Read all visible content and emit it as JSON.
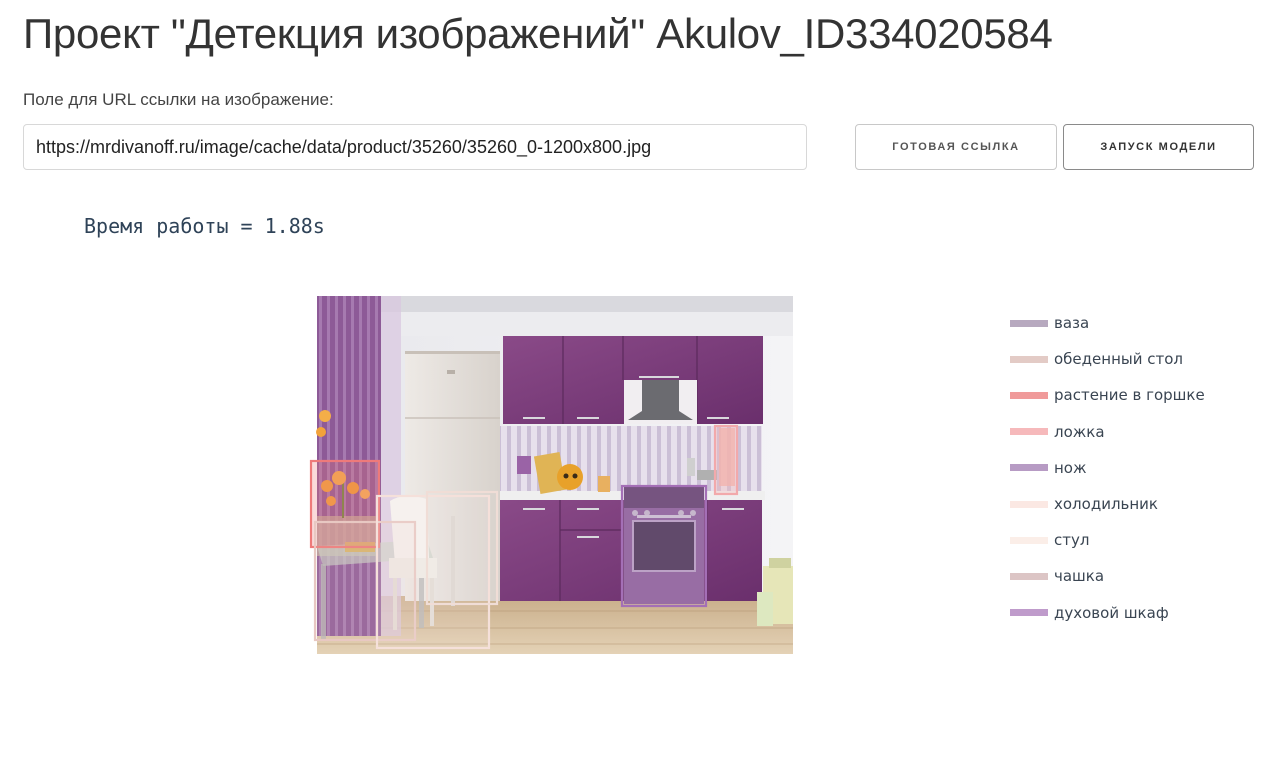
{
  "header": {
    "title": "Проект \"Детекция изображений\" Akulov_ID334020584"
  },
  "form": {
    "url_label": "Поле для URL ссылки на изображение:",
    "url_value": "https://mrdivanoff.ru/image/cache/data/product/35260/35260_0-1200x800.jpg",
    "ready_link_button": "готовая ссылка",
    "run_model_button": "запуск модели"
  },
  "result": {
    "runtime_text": "Время работы = 1.88s"
  },
  "legend": {
    "items": [
      {
        "label": "ваза",
        "color": "#b7a9bf"
      },
      {
        "label": "обеденный стол",
        "color": "#e3cbc6"
      },
      {
        "label": "растение в горшке",
        "color": "#f09a9a"
      },
      {
        "label": "ложка",
        "color": "#f6b9bb"
      },
      {
        "label": "нож",
        "color": "#b79bc4"
      },
      {
        "label": "холодильник",
        "color": "#fbe8e3"
      },
      {
        "label": "стул",
        "color": "#fbeee8"
      },
      {
        "label": "чашка",
        "color": "#dcc5c5"
      },
      {
        "label": "духовой шкаф",
        "color": "#bf9bcb"
      }
    ]
  }
}
